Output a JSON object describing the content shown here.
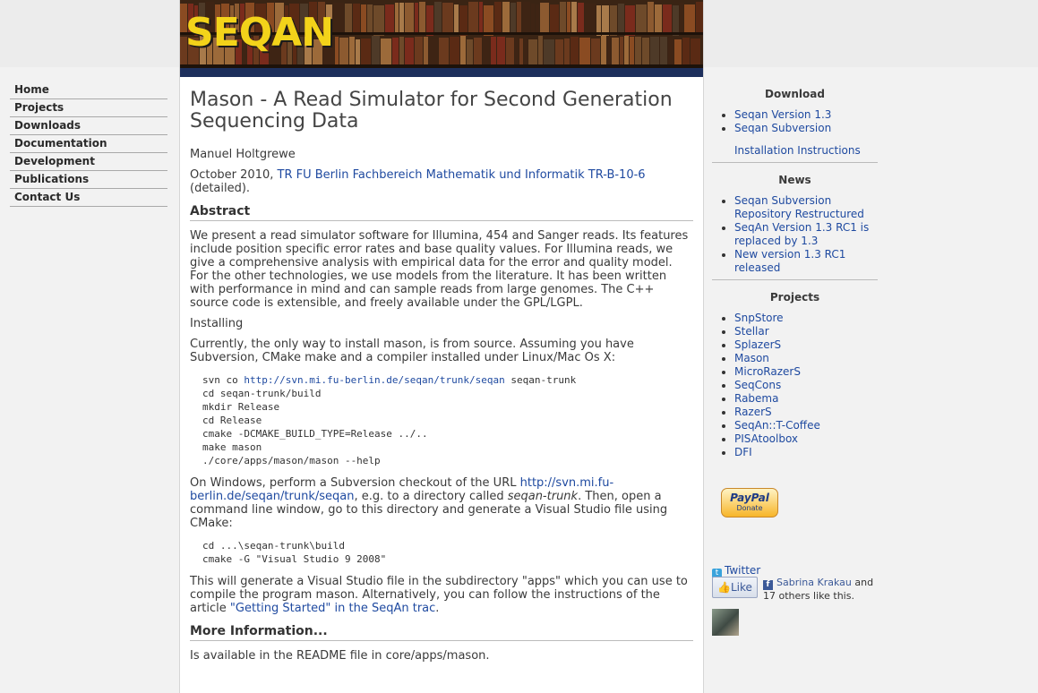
{
  "banner": {
    "logo_text": "SEQAN"
  },
  "nav": {
    "items": [
      "Home",
      "Projects",
      "Downloads",
      "Documentation",
      "Development",
      "Publications",
      "Contact Us"
    ]
  },
  "main": {
    "title": "Mason - A Read Simulator for Second Generation Sequencing Data",
    "author": "Manuel Holtgrewe",
    "date_prefix": "October 2010, ",
    "tr_link": "TR FU Berlin Fachbereich Mathematik und Informatik TR-B-10-6",
    "detailed_suffix": " (detailed).",
    "abstract_heading": "Abstract",
    "abstract_text": "We present a read simulator software for Illumina, 454 and Sanger reads. Its features include position specific error rates and base quality values. For Illumina reads, we give a comprehensive analysis with empirical data for the error and quality model. For the other technologies, we use models from the literature. It has been written with performance in mind and can sample reads from large genomes. The C++ source code is extensible, and freely available under the GPL/LGPL.",
    "installing_heading": "Installing",
    "installing_text": "Currently, the only way to install mason, is from source. Assuming you have Subversion, CMake make and a compiler installed under Linux/Mac Os X:",
    "code1": {
      "line1_prefix": "svn co ",
      "line1_link": "http://svn.mi.fu-berlin.de/seqan/trunk/seqan",
      "line1_suffix": " seqan-trunk",
      "lines": [
        "cd seqan-trunk/build",
        "mkdir Release",
        "cd Release",
        "cmake -DCMAKE_BUILD_TYPE=Release ../..",
        "make mason",
        "./core/apps/mason/mason --help"
      ]
    },
    "windows_prefix": "On Windows, perform a Subversion checkout of the URL ",
    "windows_link": "http://svn.mi.fu-berlin.de/seqan/trunk/seqan",
    "windows_mid": ", e.g. to a directory called ",
    "windows_dir": "seqan-trunk",
    "windows_suffix": ". Then, open a command line window, go to this directory and generate a Visual Studio file using CMake:",
    "code2": {
      "lines": [
        "cd ...\\seqan-trunk\\build",
        "cmake -G \"Visual Studio 9 2008\""
      ]
    },
    "apps_text": "This will generate a Visual Studio file in the subdirectory \"apps\" which you can use to compile the program mason. Alternatively, you can follow the instructions of the article ",
    "apps_link": "\"Getting Started\" in the SeqAn trac",
    "apps_suffix": ".",
    "more_heading": "More Information...",
    "more_text": "Is available in the README file in core/apps/mason."
  },
  "sidebar": {
    "download_heading": "Download",
    "download_items": [
      "Seqan Version 1.3",
      "Seqan Subversion"
    ],
    "install_link": "Installation Instructions",
    "news_heading": "News",
    "news_items": [
      "Seqan Subversion Repository Restructured",
      "SeqAn Version 1.3 RC1 is replaced by 1.3",
      "New version 1.3 RC1 released"
    ],
    "projects_heading": "Projects",
    "project_items": [
      "SnpStore",
      "Stellar",
      "SplazerS",
      "Mason",
      "MicroRazerS",
      "SeqCons",
      "Rabema",
      "RazerS",
      "SeqAn::T-Coffee",
      "PISAtoolbox",
      "DFI"
    ],
    "paypal_logo": "PayPal",
    "paypal_donate": "Donate",
    "twitter_label": "Twitter",
    "like_label": "Like",
    "fb_name": "Sabrina Krakau",
    "fb_and": " and",
    "fb_rest": "17 others like this."
  }
}
